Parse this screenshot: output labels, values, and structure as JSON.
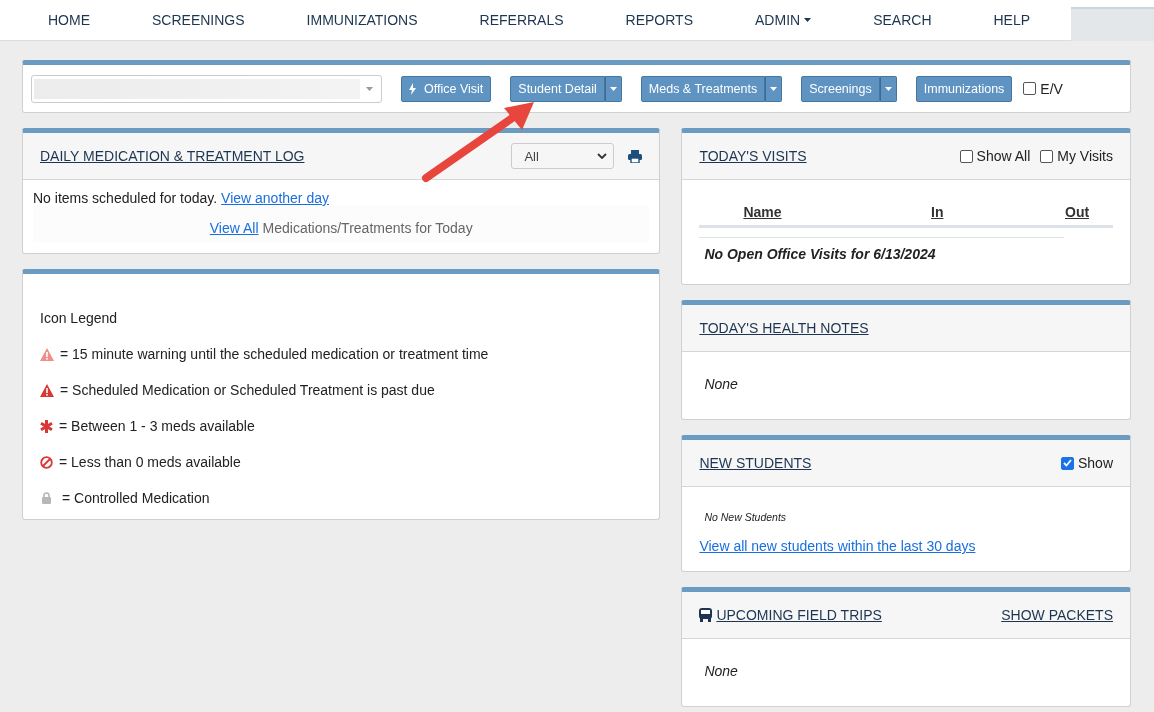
{
  "nav": [
    {
      "label": "HOME",
      "dropdown": false
    },
    {
      "label": "SCREENINGS",
      "dropdown": false
    },
    {
      "label": "IMMUNIZATIONS",
      "dropdown": false
    },
    {
      "label": "REFERRALS",
      "dropdown": false
    },
    {
      "label": "REPORTS",
      "dropdown": false
    },
    {
      "label": "ADMIN",
      "dropdown": true
    },
    {
      "label": "SEARCH",
      "dropdown": false
    },
    {
      "label": "HELP",
      "dropdown": false
    }
  ],
  "toolbar": {
    "buttons": [
      {
        "label": "Office Visit",
        "kind": "icon"
      },
      {
        "label": "Student Detail",
        "kind": "split"
      },
      {
        "label": "Meds & Treatments",
        "kind": "split"
      },
      {
        "label": "Screenings",
        "kind": "split"
      },
      {
        "label": "Immunizations",
        "kind": "plain"
      }
    ],
    "checkbox": {
      "label": "E/V",
      "checked": false
    }
  },
  "med_log": {
    "title": "DAILY MEDICATION & TREATMENT LOG",
    "filter": "All",
    "message": "No items scheduled for today.",
    "message_link": "View another day",
    "footer_link": "View All",
    "footer_text": "Medications/Treatments for Today"
  },
  "legend": {
    "title": "Icon Legend",
    "items": [
      {
        "kind": "warning-light",
        "text": "= 15 minute warning until the scheduled medication or treatment time"
      },
      {
        "kind": "warning",
        "text": "= Scheduled Medication or Scheduled Treatment is past due"
      },
      {
        "kind": "asterisk",
        "text": "= Between 1 - 3 meds available"
      },
      {
        "kind": "ban",
        "text": "= Less than 0 meds available"
      },
      {
        "kind": "lock",
        "text": "= Controlled Medication"
      }
    ]
  },
  "visits": {
    "title": "TODAY'S VISITS",
    "toggles": [
      {
        "label": "Show All",
        "checked": false
      },
      {
        "label": "My Visits",
        "checked": false
      }
    ],
    "columns": [
      "Name",
      "In",
      "Out"
    ],
    "empty": "No Open Office Visits for 6/13/2024"
  },
  "health_notes": {
    "title": "TODAY'S HEALTH NOTES",
    "body": "None"
  },
  "new_students": {
    "title": "NEW STUDENTS",
    "toggle": {
      "label": "Show",
      "checked": true
    },
    "body": "No New Students",
    "link": "View all new students within the last 30 days"
  },
  "field_trips": {
    "title": "UPCOMING FIELD TRIPS",
    "action": "SHOW PACKETS",
    "body": "None"
  }
}
